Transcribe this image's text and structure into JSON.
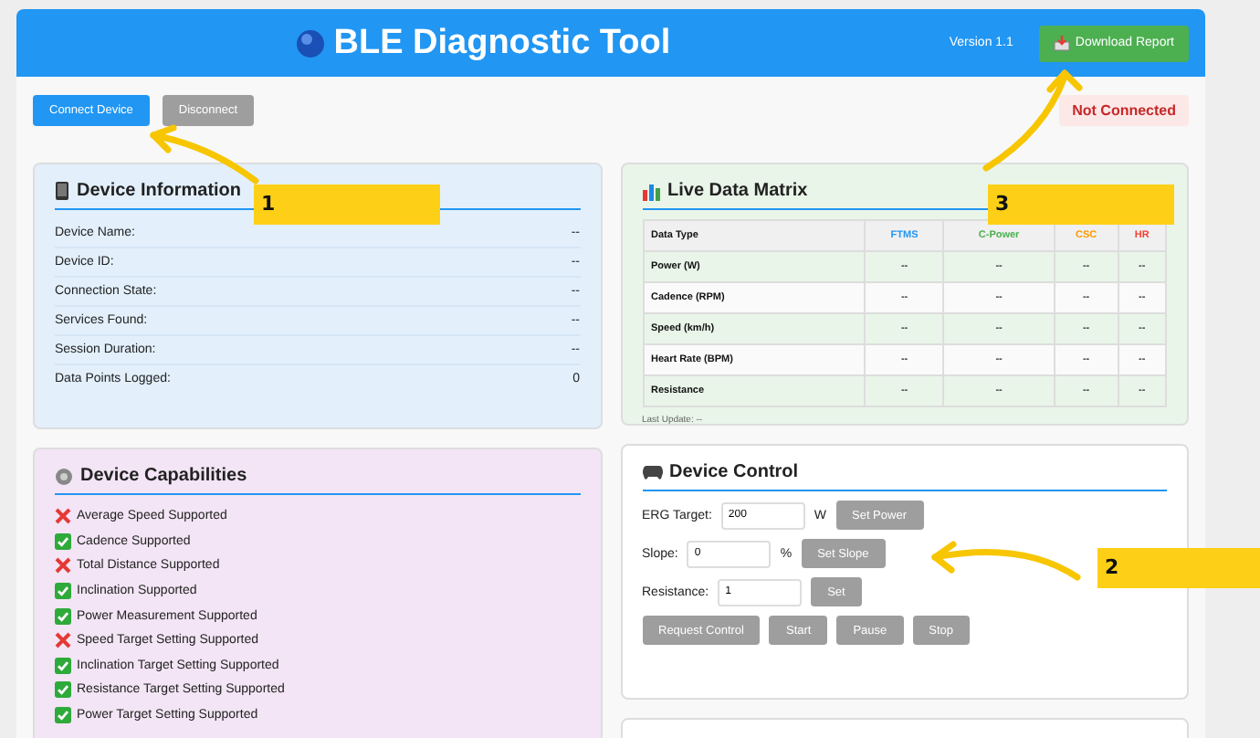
{
  "header": {
    "title": "BLE Diagnostic Tool",
    "version": "Version 1.1",
    "download_button": "Download Report"
  },
  "toolbar": {
    "buttons": [
      {
        "label": "Connect Device",
        "disabled": false
      },
      {
        "label": "Disconnect",
        "disabled": true
      }
    ],
    "status": "Not Connected"
  },
  "device_information": {
    "title": "Device Information",
    "fields": [
      {
        "label": "Device Name:",
        "value": "--"
      },
      {
        "label": "Device ID:",
        "value": "--"
      },
      {
        "label": "Connection State:",
        "value": "--"
      },
      {
        "label": "Services Found:",
        "value": "--"
      },
      {
        "label": "Session Duration:",
        "value": "--"
      },
      {
        "label": "Data Points Logged:",
        "value": "0"
      }
    ]
  },
  "live_data_matrix": {
    "title": "Live Data Matrix",
    "columns": [
      {
        "label": "Data Type"
      },
      {
        "label": "FTMS",
        "color": "#2196f3"
      },
      {
        "label": "C-Power",
        "color": "#4caf50"
      },
      {
        "label": "CSC",
        "color": "#ff9800"
      },
      {
        "label": "HR",
        "color": "#f44336"
      }
    ],
    "rows": [
      {
        "cells": [
          "Power (W)",
          "--",
          "--",
          "--",
          "--"
        ]
      },
      {
        "cells": [
          "Cadence (RPM)",
          "--",
          "--",
          "--",
          "--"
        ]
      },
      {
        "cells": [
          "Speed (km/h)",
          "--",
          "--",
          "--",
          "--"
        ]
      },
      {
        "cells": [
          "Heart Rate (BPM)",
          "--",
          "--",
          "--",
          "--"
        ]
      },
      {
        "cells": [
          "Resistance",
          "--",
          "--",
          "--",
          "--"
        ]
      }
    ],
    "last_update": "Last Update: --"
  },
  "device_capabilities": {
    "title": "Device Capabilities",
    "items": [
      {
        "label": "Average Speed Supported",
        "supported": false
      },
      {
        "label": "Cadence Supported",
        "supported": true
      },
      {
        "label": "Total Distance Supported",
        "supported": false
      },
      {
        "label": "Inclination Supported",
        "supported": true
      },
      {
        "label": "Power Measurement Supported",
        "supported": true
      },
      {
        "label": "Speed Target Setting Supported",
        "supported": false
      },
      {
        "label": "Inclination Target Setting Supported",
        "supported": true
      },
      {
        "label": "Resistance Target Setting Supported",
        "supported": true
      },
      {
        "label": "Power Target Setting Supported",
        "supported": true
      }
    ]
  },
  "device_control": {
    "title": "Device Control",
    "inputs": [
      {
        "label": "ERG Target:",
        "value": "200",
        "unit": "W",
        "button": "Set Power",
        "disabled": true
      },
      {
        "label": "Slope:",
        "value": "0",
        "unit": "%",
        "button": "Set Slope",
        "disabled": true
      },
      {
        "label": "Resistance:",
        "value": "1",
        "button": "Set",
        "disabled": true
      }
    ],
    "actions": [
      {
        "label": "Request Control",
        "disabled": true
      },
      {
        "label": "Start",
        "disabled": true
      },
      {
        "label": "Pause",
        "disabled": true
      },
      {
        "label": "Stop",
        "disabled": true
      }
    ]
  },
  "annotations": [
    {
      "label": "1"
    },
    {
      "label": "2"
    },
    {
      "label": "3"
    }
  ]
}
